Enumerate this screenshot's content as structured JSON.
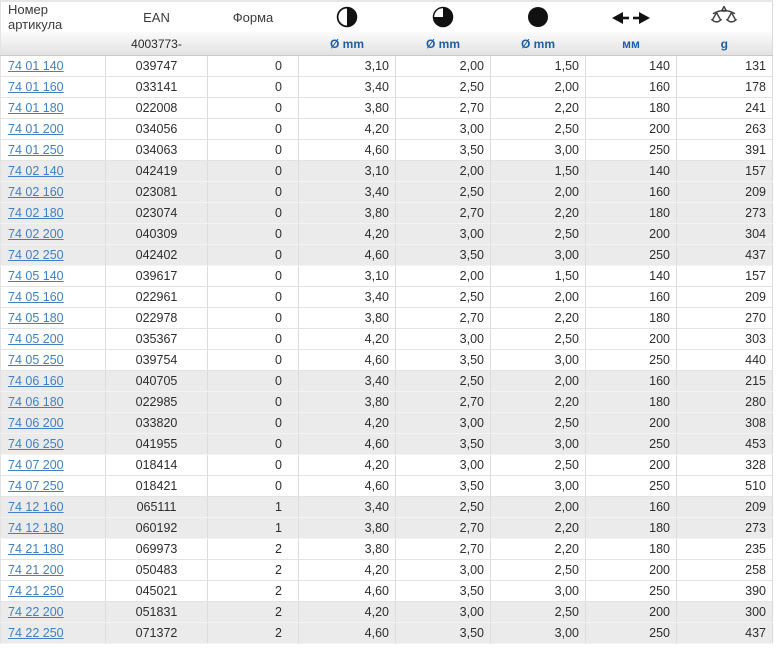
{
  "colors": {
    "link_blue": "#4181c2",
    "unit_blue": "#1d5fa6",
    "row_shaded": "#ebebeb",
    "icon_black": "#111111"
  },
  "header": {
    "columns": [
      {
        "label": "Номер артикула",
        "sub": "",
        "icon": ""
      },
      {
        "label": "EAN",
        "sub": "4003773-",
        "icon": ""
      },
      {
        "label": "Форма",
        "sub": "",
        "icon": ""
      },
      {
        "label": "",
        "sub": "Ø mm",
        "icon": "circle-half"
      },
      {
        "label": "",
        "sub": "Ø mm",
        "icon": "circle-three-quarter"
      },
      {
        "label": "",
        "sub": "Ø mm",
        "icon": "circle-full"
      },
      {
        "label": "",
        "sub": "мм",
        "icon": "arrows-left-right"
      },
      {
        "label": "",
        "sub": "g",
        "icon": "scales"
      }
    ]
  },
  "table": {
    "rows": [
      [
        "74 01 140",
        "039747",
        "0",
        "3,10",
        "2,00",
        "1,50",
        "140",
        "131"
      ],
      [
        "74 01 160",
        "033141",
        "0",
        "3,40",
        "2,50",
        "2,00",
        "160",
        "178"
      ],
      [
        "74 01 180",
        "022008",
        "0",
        "3,80",
        "2,70",
        "2,20",
        "180",
        "241"
      ],
      [
        "74 01 200",
        "034056",
        "0",
        "4,20",
        "3,00",
        "2,50",
        "200",
        "263"
      ],
      [
        "74 01 250",
        "034063",
        "0",
        "4,60",
        "3,50",
        "3,00",
        "250",
        "391"
      ],
      [
        "74 02 140",
        "042419",
        "0",
        "3,10",
        "2,00",
        "1,50",
        "140",
        "157"
      ],
      [
        "74 02 160",
        "023081",
        "0",
        "3,40",
        "2,50",
        "2,00",
        "160",
        "209"
      ],
      [
        "74 02 180",
        "023074",
        "0",
        "3,80",
        "2,70",
        "2,20",
        "180",
        "273"
      ],
      [
        "74 02 200",
        "040309",
        "0",
        "4,20",
        "3,00",
        "2,50",
        "200",
        "304"
      ],
      [
        "74 02 250",
        "042402",
        "0",
        "4,60",
        "3,50",
        "3,00",
        "250",
        "437"
      ],
      [
        "74 05 140",
        "039617",
        "0",
        "3,10",
        "2,00",
        "1,50",
        "140",
        "157"
      ],
      [
        "74 05 160",
        "022961",
        "0",
        "3,40",
        "2,50",
        "2,00",
        "160",
        "209"
      ],
      [
        "74 05 180",
        "022978",
        "0",
        "3,80",
        "2,70",
        "2,20",
        "180",
        "270"
      ],
      [
        "74 05 200",
        "035367",
        "0",
        "4,20",
        "3,00",
        "2,50",
        "200",
        "303"
      ],
      [
        "74 05 250",
        "039754",
        "0",
        "4,60",
        "3,50",
        "3,00",
        "250",
        "440"
      ],
      [
        "74 06 160",
        "040705",
        "0",
        "3,40",
        "2,50",
        "2,00",
        "160",
        "215"
      ],
      [
        "74 06 180",
        "022985",
        "0",
        "3,80",
        "2,70",
        "2,20",
        "180",
        "280"
      ],
      [
        "74 06 200",
        "033820",
        "0",
        "4,20",
        "3,00",
        "2,50",
        "200",
        "308"
      ],
      [
        "74 06 250",
        "041955",
        "0",
        "4,60",
        "3,50",
        "3,00",
        "250",
        "453"
      ],
      [
        "74 07 200",
        "018414",
        "0",
        "4,20",
        "3,00",
        "2,50",
        "200",
        "328"
      ],
      [
        "74 07 250",
        "018421",
        "0",
        "4,60",
        "3,50",
        "3,00",
        "250",
        "510"
      ],
      [
        "74 12 160",
        "065111",
        "1",
        "3,40",
        "2,50",
        "2,00",
        "160",
        "209"
      ],
      [
        "74 12 180",
        "060192",
        "1",
        "3,80",
        "2,70",
        "2,20",
        "180",
        "273"
      ],
      [
        "74 21 180",
        "069973",
        "2",
        "3,80",
        "2,70",
        "2,20",
        "180",
        "235"
      ],
      [
        "74 21 200",
        "050483",
        "2",
        "4,20",
        "3,00",
        "2,50",
        "200",
        "258"
      ],
      [
        "74 21 250",
        "045021",
        "2",
        "4,60",
        "3,50",
        "3,00",
        "250",
        "390"
      ],
      [
        "74 22 200",
        "051831",
        "2",
        "4,20",
        "3,00",
        "2,50",
        "200",
        "300"
      ],
      [
        "74 22 250",
        "071372",
        "2",
        "4,60",
        "3,50",
        "3,00",
        "250",
        "437"
      ]
    ]
  }
}
